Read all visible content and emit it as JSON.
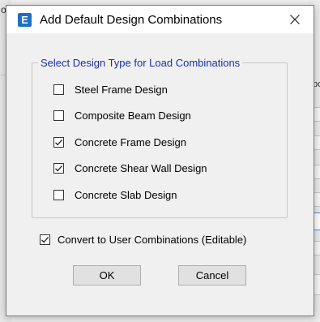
{
  "background_app": {
    "left_fragment": "or",
    "right_fragment": "bo"
  },
  "dialog": {
    "app_icon_letter": "E",
    "title": "Add Default Design Combinations",
    "group_label": "Select Design Type for Load Combinations",
    "design_types": [
      {
        "label": "Steel Frame Design",
        "checked": false
      },
      {
        "label": "Composite Beam Design",
        "checked": false
      },
      {
        "label": "Concrete Frame Design",
        "checked": true
      },
      {
        "label": "Concrete Shear Wall Design",
        "checked": true
      },
      {
        "label": "Concrete Slab Design",
        "checked": false
      }
    ],
    "convert_option": {
      "label": "Convert to User Combinations (Editable)",
      "checked": true
    },
    "ok_label": "OK",
    "cancel_label": "Cancel"
  },
  "colors": {
    "group_label": "#1a2fa6",
    "app_icon": "#1e6fc3"
  },
  "icons": {
    "close": "close-icon",
    "check": "checkmark-icon",
    "app": "etabs-app-icon"
  }
}
